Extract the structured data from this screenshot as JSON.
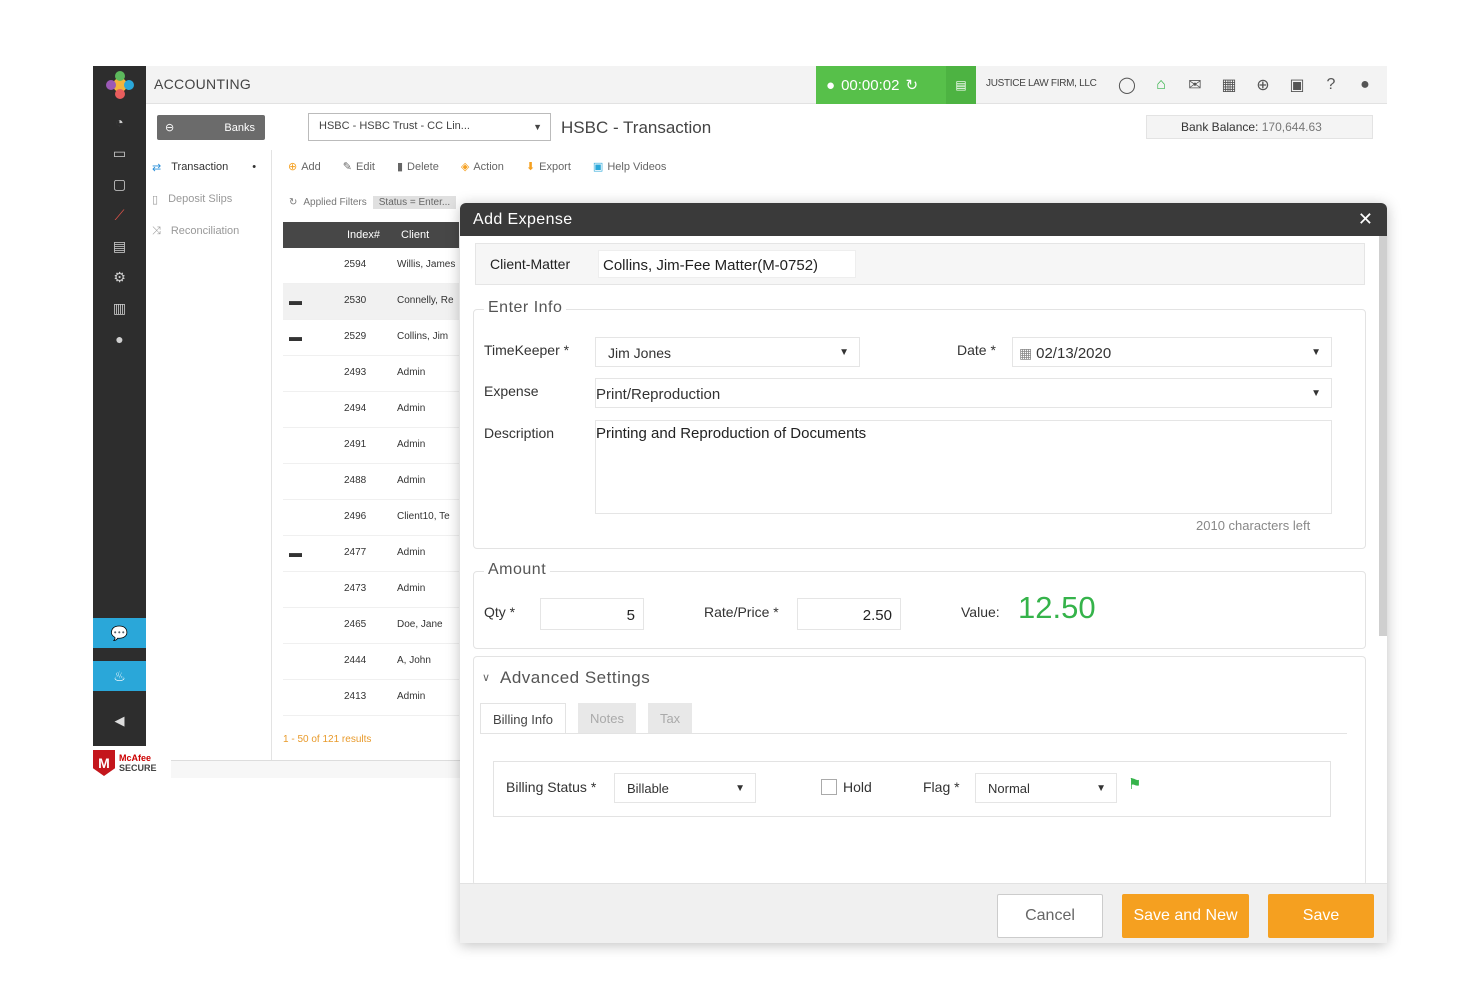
{
  "app": {
    "section_title": "ACCOUNTING",
    "timer": "00:00:02",
    "firm_name": "JUSTICE LAW FIRM, LLC"
  },
  "header": {
    "banks_button": "Banks",
    "bank_select": "HSBC - HSBC Trust - CC Lin...",
    "page_title": "HSBC - Transaction",
    "bank_balance_label": "Bank Balance:",
    "bank_balance_value": "170,644.63"
  },
  "subnav": {
    "items": [
      {
        "label": "Transaction"
      },
      {
        "label": "Deposit Slips"
      },
      {
        "label": "Reconciliation"
      }
    ]
  },
  "toolbar": {
    "add": "Add",
    "edit": "Edit",
    "delete": "Delete",
    "action": "Action",
    "export": "Export",
    "help_videos": "Help Videos"
  },
  "filters": {
    "label": "Applied Filters",
    "chip": "Status = Enter..."
  },
  "table": {
    "columns": [
      "Index#",
      "Client"
    ],
    "rows": [
      {
        "index": "2594",
        "client": "Willis, James"
      },
      {
        "index": "2530",
        "client": "Connelly, Re"
      },
      {
        "index": "2529",
        "client": "Collins, Jim"
      },
      {
        "index": "2493",
        "client": "Admin"
      },
      {
        "index": "2494",
        "client": "Admin"
      },
      {
        "index": "2491",
        "client": "Admin"
      },
      {
        "index": "2488",
        "client": "Admin"
      },
      {
        "index": "2496",
        "client": "Client10, Te"
      },
      {
        "index": "2477",
        "client": "Admin"
      },
      {
        "index": "2473",
        "client": "Admin"
      },
      {
        "index": "2465",
        "client": "Doe, Jane"
      },
      {
        "index": "2444",
        "client": "A, John"
      },
      {
        "index": "2413",
        "client": "Admin"
      }
    ],
    "results": "1 - 50 of 121 results"
  },
  "mcafee": {
    "line1": "McAfee",
    "line2": "SECURE"
  },
  "modal": {
    "title": "Add Expense",
    "client_matter_label": "Client-Matter",
    "client_matter_value": "Collins, Jim-Fee Matter(M-0752)",
    "enter_info": {
      "legend": "Enter Info",
      "timekeeper_label": "TimeKeeper *",
      "timekeeper_value": "Jim Jones",
      "date_label": "Date *",
      "date_value": "02/13/2020",
      "expense_label": "Expense",
      "expense_value": "Print/Reproduction",
      "description_label": "Description",
      "description_value": "Printing and Reproduction of Documents",
      "chars_left": "2010 characters left"
    },
    "amount": {
      "legend": "Amount",
      "qty_label": "Qty *",
      "qty_value": "5",
      "rate_label": "Rate/Price *",
      "rate_value": "2.50",
      "value_label": "Value:",
      "value": "12.50"
    },
    "advanced": {
      "legend": "Advanced Settings",
      "tabs": [
        "Billing Info",
        "Notes",
        "Tax"
      ],
      "billing_status_label": "Billing Status *",
      "billing_status_value": "Billable",
      "hold_label": "Hold",
      "flag_label": "Flag *",
      "flag_value": "Normal"
    },
    "buttons": {
      "cancel": "Cancel",
      "save_new": "Save and New",
      "save": "Save"
    }
  },
  "colors": {
    "accent_orange": "#f5a020",
    "timer_green": "#57c04a",
    "value_green": "#35b34a",
    "rail_dark": "#2d2d2d",
    "rail_blue": "#2aa7d9"
  }
}
